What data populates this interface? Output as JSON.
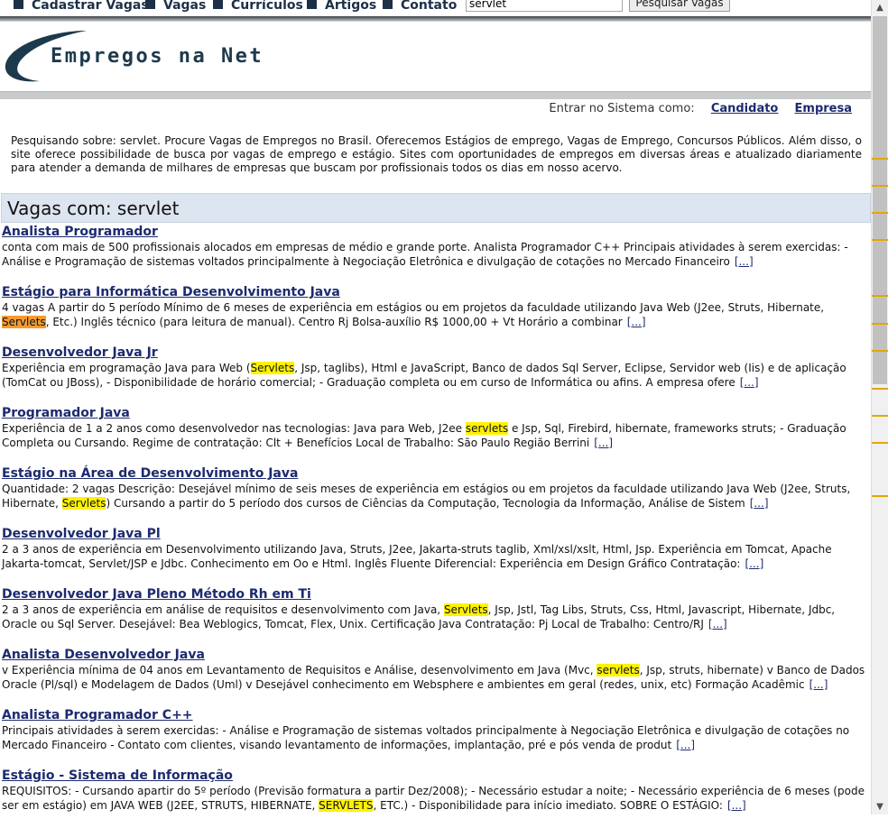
{
  "nav": {
    "items": [
      {
        "label": "Cadastrar Vagas"
      },
      {
        "label": "Vagas"
      },
      {
        "label": "Currículos"
      },
      {
        "label": "Artigos"
      },
      {
        "label": "Contato"
      }
    ],
    "search_value": "servlet",
    "search_button": "Pesquisar Vagas"
  },
  "logo": {
    "text": "Empregos na Net",
    "color": "#1d3a4c"
  },
  "login": {
    "prompt": "Entrar no Sistema como:",
    "candidate": "Candidato",
    "company": "Empresa"
  },
  "intro": "Pesquisando sobre: servlet. Procure Vagas de Empregos no Brasil. Oferecemos Estágios de emprego, Vagas de Emprego, Concursos Públicos. Além disso, o site oferece possibilidade de busca por vagas de emprego e estágio. Sites com oportunidades de empregos em diversas áreas e atualizado diariamente para atender a demanda de milhares de empresas que buscam por profissionais todos os dias em nosso acervo.",
  "section_title": "Vagas com: servlet",
  "more_label": "[...]",
  "colors": {
    "link": "#1c2a6e",
    "highlight": "#fff200",
    "highlight_active": "#f39b33",
    "section_bg": "#dde5f0"
  },
  "jobs": [
    {
      "title": "Analista Programador",
      "parts": [
        {
          "t": "conta com mais de 500 profissionais alocados em empresas de médio e grande porte. Analista Programador C++ Principais atividades à serem exercidas: - Análise e Programação de sistemas voltados principalmente à Negociação Eletrônica e divulgação de cotações no Mercado Financeiro"
        }
      ]
    },
    {
      "title": "Estágio para Informática Desenvolvimento Java",
      "parts": [
        {
          "t": "4 vagas A partir do 5 período Mínimo de 6 meses de experiência em estágios ou em projetos da faculdade utilizando Java Web (J2ee, Struts, Hibernate, "
        },
        {
          "t": "Servlets",
          "h": "orange"
        },
        {
          "t": ", Etc.) Inglês técnico (para leitura de manual). Centro Rj Bolsa-auxílio R$ 1000,00 + Vt Horário a combinar"
        }
      ]
    },
    {
      "title": "Desenvolvedor Java Jr",
      "parts": [
        {
          "t": "Experiência em programação Java para Web ("
        },
        {
          "t": "Servlets",
          "h": "yellow"
        },
        {
          "t": ", Jsp, taglibs), Html e JavaScript, Banco de dados Sql Server, Eclipse, Servidor web (Iis) e de aplicação (TomCat ou JBoss), - Disponibilidade de horário comercial; - Graduação completa ou em curso de Informática ou afins. A empresa ofere"
        }
      ]
    },
    {
      "title": "Programador Java",
      "parts": [
        {
          "t": "Experiência de 1 a 2 anos como desenvolvedor nas tecnologias: Java para Web, J2ee "
        },
        {
          "t": "servlets",
          "h": "yellow"
        },
        {
          "t": " e Jsp, Sql, Firebird, hibernate, frameworks struts; - Graduação Completa ou Cursando. Regime de contratação: Clt + Benefícios Local de Trabalho: São Paulo Região Berrini"
        }
      ]
    },
    {
      "title": "Estágio na Área de Desenvolvimento Java",
      "parts": [
        {
          "t": "Quantidade: 2 vagas Descrição: Desejável mínimo de seis meses de experiência em estágios ou em projetos da faculdade utilizando Java Web (J2ee, Struts, Hibernate, "
        },
        {
          "t": "Servlets",
          "h": "yellow"
        },
        {
          "t": ") Cursando a partir do 5 período dos cursos de Ciências da Computação, Tecnologia da Informação, Análise de Sistem"
        }
      ]
    },
    {
      "title": "Desenvolvedor Java Pl",
      "parts": [
        {
          "t": "2 a 3 anos de experiência em Desenvolvimento utilizando Java, Struts, J2ee, Jakarta-struts taglib, Xml/xsl/xslt, Html, Jsp. Experiência em Tomcat, Apache Jakarta-tomcat, Servlet/JSP e Jdbc. Conhecimento em Oo e Html. Inglês Fluente Diferencial: Experiência em Design Gráfico Contratação:"
        }
      ]
    },
    {
      "title": "Desenvolvedor Java Pleno Método Rh em Ti",
      "parts": [
        {
          "t": "2 a 3 anos de experiência em análise de requisitos e desenvolvimento com Java, "
        },
        {
          "t": "Servlets",
          "h": "yellow"
        },
        {
          "t": ", Jsp, Jstl, Tag Libs, Struts, Css, Html, Javascript, Hibernate, Jdbc, Oracle ou Sql Server. Desejável: Bea Weblogics, Tomcat, Flex, Unix. Certificação Java Contratação: Pj Local de Trabalho: Centro/RJ"
        }
      ]
    },
    {
      "title": "Analista Desenvolvedor Java",
      "parts": [
        {
          "t": "v Experiência mínima de 04 anos em Levantamento de Requisitos e Análise, desenvolvimento em Java (Mvc, "
        },
        {
          "t": "servlets",
          "h": "yellow"
        },
        {
          "t": ", Jsp, struts, hibernate) v Banco de Dados Oracle (Pl/sql) e Modelagem de Dados (Uml) v Desejável conhecimento em Websphere e ambientes em geral (redes, unix, etc) Formação Acadêmic"
        }
      ]
    },
    {
      "title": "Analista Programador C++",
      "parts": [
        {
          "t": "Principais atividades à serem exercidas: - Análise e Programação de sistemas voltados principalmente à Negociação Eletrônica e divulgação de cotações no Mercado Financeiro - Contato com clientes, visando levantamento de informações, implantação, pré e pós venda de produt"
        }
      ]
    },
    {
      "title": "Estágio - Sistema de Informação",
      "parts": [
        {
          "t": "REQUISITOS: - Cursando apartir do 5º período (Previsão formatura a partir Dez/2008); - Necessário estudar a noite; - Necessário experiência de 6 meses (pode ser em estágio) em JAVA WEB (J2EE, STRUTS, HIBERNATE, "
        },
        {
          "t": "SERVLETS",
          "h": "yellow"
        },
        {
          "t": ", ETC.) - Disponibilidade para início imediato. SOBRE O ESTÁGIO:"
        }
      ]
    }
  ]
}
